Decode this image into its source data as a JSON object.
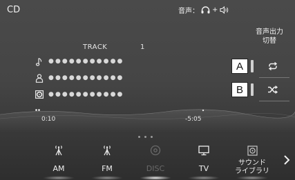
{
  "header": {
    "source_title": "CD",
    "voice_label": "音声：",
    "plus": "+"
  },
  "audio_output": {
    "line1": "音声出力",
    "line2": "切替"
  },
  "track": {
    "label": "TRACK",
    "number": "1"
  },
  "info_rows": [
    {
      "icon": "music-note-icon",
      "value": "●●●●●●●●●●●"
    },
    {
      "icon": "artist-icon",
      "value": "●●●●●●●●●●●"
    },
    {
      "icon": "disc-icon",
      "value": "●●●●●●●●●●●"
    }
  ],
  "callouts": {
    "a": "A",
    "b": "B"
  },
  "controls": {
    "repeat": "repeat-icon",
    "shuffle": "shuffle-icon"
  },
  "playback": {
    "elapsed": "0:10",
    "remaining": "-5:05",
    "progress": 0.03
  },
  "tabs": [
    {
      "label": "AM",
      "icon": "antenna-icon",
      "active": false
    },
    {
      "label": "FM",
      "icon": "antenna-icon",
      "active": false
    },
    {
      "label": "DISC",
      "icon": "disc-icon",
      "active": true
    },
    {
      "label": "TV",
      "icon": "tv-icon",
      "active": false
    },
    {
      "label_line1": "サウンド",
      "label_line2": "ライブラリ",
      "icon": "sound-library-icon",
      "active": false
    }
  ],
  "colors": {
    "background_top": "#4a4a4a",
    "background_bottom": "#2e2e2e",
    "text": "#f0f0f0",
    "active_tab_text": "#6a6a6a"
  }
}
